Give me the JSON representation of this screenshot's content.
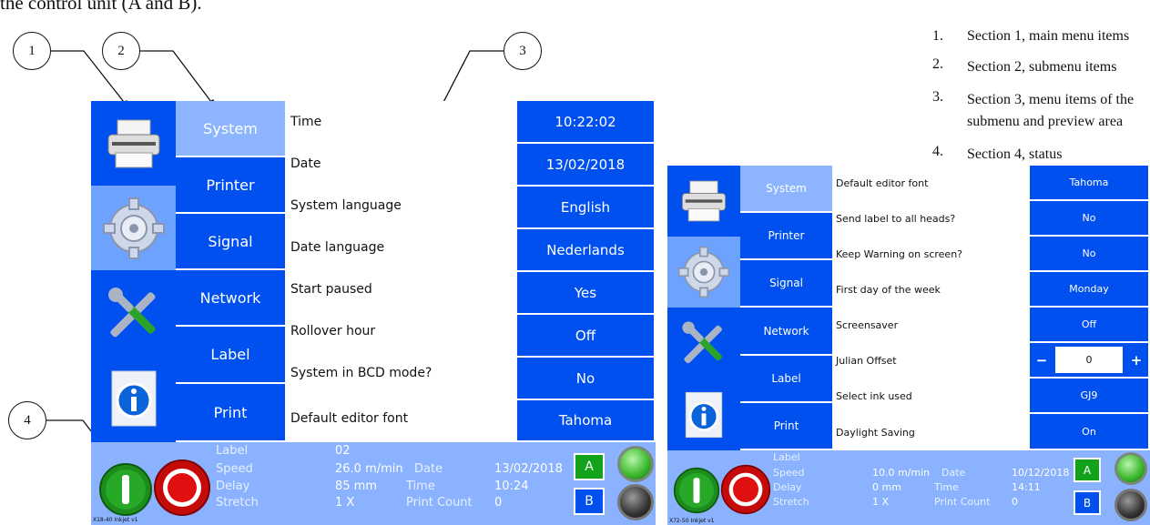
{
  "intro_text": "the control unit (A and B).",
  "callouts": [
    "1",
    "2",
    "3",
    "4"
  ],
  "legend": [
    {
      "num": "1.",
      "text": "Section 1, main menu items"
    },
    {
      "num": "2.",
      "text": "Section 2, submenu items"
    },
    {
      "num": "3.",
      "text": "Section 3, menu items of the submenu and preview area"
    },
    {
      "num": "4.",
      "text": "Section 4, status"
    }
  ],
  "icons": [
    "printer-icon",
    "gear-icon",
    "tools-icon",
    "info-icon"
  ],
  "colors": {
    "menu_blue": "#0050f0",
    "selected_blue": "#8db4ff",
    "status_blue": "#8ab2ff",
    "ab_green": "#12a31a",
    "ab_blue": "#0050f0"
  },
  "screen1": {
    "submenu": [
      "System",
      "Printer",
      "Signal",
      "Network",
      "Label",
      "Print"
    ],
    "selected_submenu": "System",
    "settings": [
      {
        "label": "Time",
        "value": "10:22:02"
      },
      {
        "label": "Date",
        "value": "13/02/2018"
      },
      {
        "label": "System language",
        "value": "English"
      },
      {
        "label": "Date language",
        "value": "Nederlands"
      },
      {
        "label": "Start paused",
        "value": "Yes"
      },
      {
        "label": "Rollover hour",
        "value": "Off"
      },
      {
        "label": "System in BCD mode?",
        "value": "No"
      },
      {
        "label": "Default editor font",
        "value": "Tahoma"
      }
    ],
    "status": {
      "label_lbl": "Label",
      "label_val": "02",
      "speed_lbl": "Speed",
      "speed_val": "26.0 m/min",
      "delay_lbl": "Delay",
      "delay_val": "85 mm",
      "stretch_lbl": "Stretch",
      "stretch_val": "1 X",
      "date_lbl": "Date",
      "date_val": "13/02/2018",
      "time_lbl": "Time",
      "time_val": "10:24",
      "count_lbl": "Print Count",
      "count_val": "0",
      "btn_a": "A",
      "btn_b": "B",
      "model": "X18-40 Inkjet v1"
    }
  },
  "screen2": {
    "submenu": [
      "System",
      "Printer",
      "Signal",
      "Network",
      "Label",
      "Print"
    ],
    "selected_submenu": "System",
    "settings": [
      {
        "label": "Default editor font",
        "value": "Tahoma"
      },
      {
        "label": "Send label to all heads?",
        "value": "No"
      },
      {
        "label": "Keep Warning on screen?",
        "value": "No"
      },
      {
        "label": "First day of the week",
        "value": "Monday"
      },
      {
        "label": "Screensaver",
        "value": "Off"
      },
      {
        "label": "Julian Offset",
        "minus": "−",
        "value": "0",
        "plus": "+"
      },
      {
        "label": "Select ink used",
        "value": "GJ9"
      },
      {
        "label": "Daylight Saving",
        "value": "On"
      }
    ],
    "status": {
      "label_lbl": "Label",
      "label_val": "",
      "speed_lbl": "Speed",
      "speed_val": "10.0 m/min",
      "delay_lbl": "Delay",
      "delay_val": "0 mm",
      "stretch_lbl": "Stretch",
      "stretch_val": "1 X",
      "date_lbl": "Date",
      "date_val": "10/12/2018",
      "time_lbl": "Time",
      "time_val": "14:11",
      "count_lbl": "Print Count",
      "count_val": "0",
      "btn_a": "A",
      "btn_b": "B",
      "model": "X72-50 Inkjet v1"
    }
  }
}
